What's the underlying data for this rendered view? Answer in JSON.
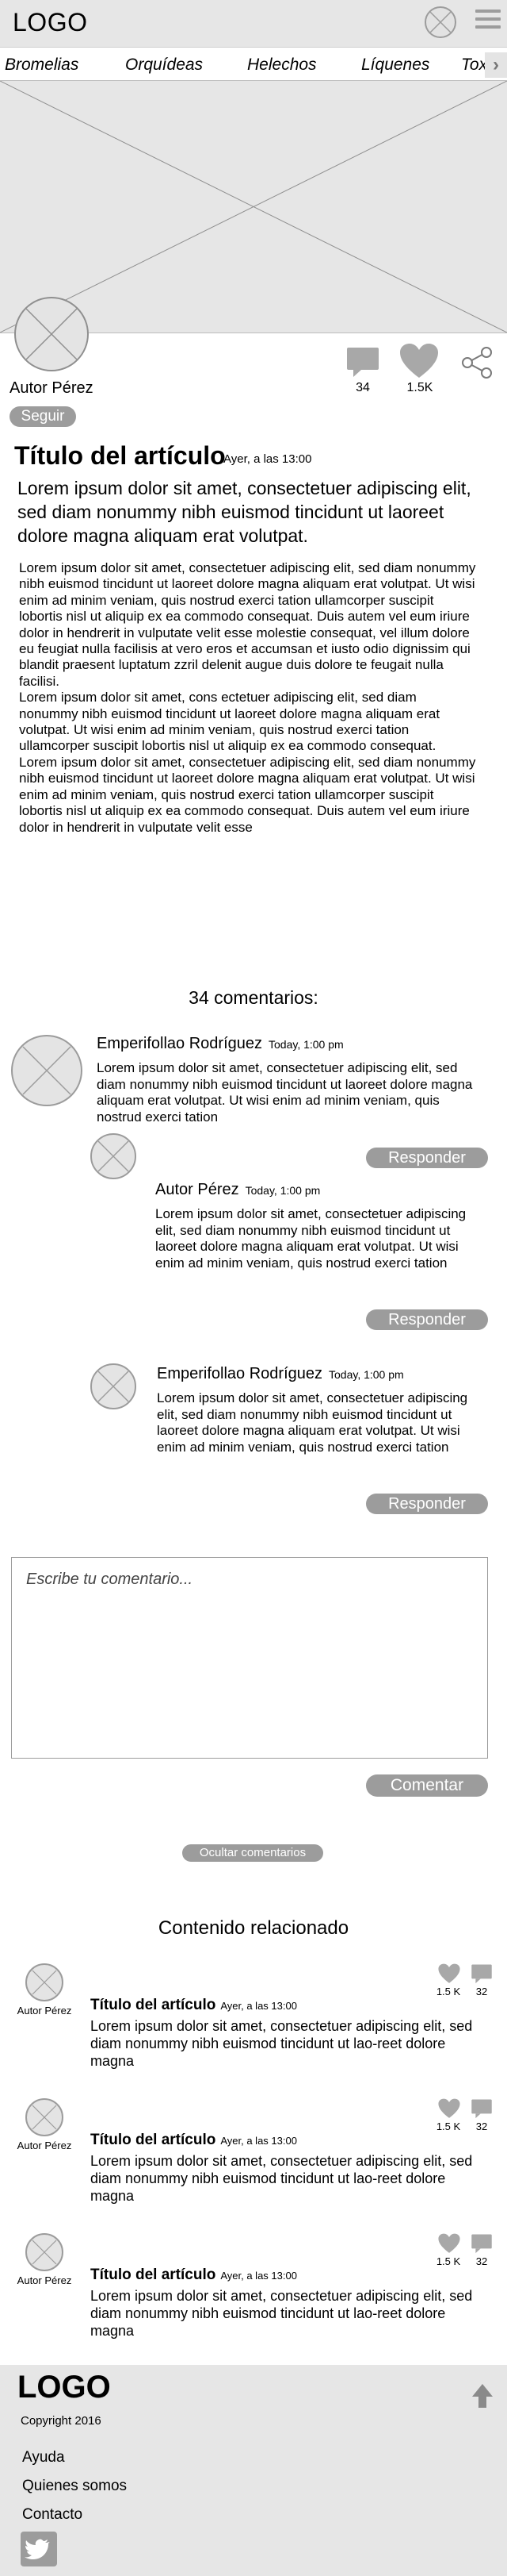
{
  "header": {
    "logo": "LOGO"
  },
  "nav": {
    "items": [
      "Bromelias",
      "Orquídeas",
      "Helechos",
      "Líquenes",
      "Tox"
    ]
  },
  "article": {
    "author": "Autor Pérez",
    "follow_label": "Seguir",
    "comment_count_label": "34",
    "likes_label": "1.5K",
    "title": "Título del artículo",
    "date": "Ayer, a las 13:00",
    "lead": "Lorem ipsum dolor sit amet, consectetuer adipiscing elit, sed diam nonummy nibh euismod tincidunt ut laoreet dolore magna aliquam erat volutpat.",
    "paragraphs": [
      "Lorem ipsum dolor sit amet, consectetuer adipiscing elit, sed diam nonummy nibh euismod tincidunt ut laoreet dolore magna aliquam erat volutpat. Ut wisi enim ad minim veniam, quis nostrud exerci tation ullamcorper suscipit lobortis nisl ut aliquip ex ea commodo consequat. Duis autem vel eum iriure dolor in hendrerit in vulputate velit esse molestie consequat, vel illum dolore eu feugiat nulla facilisis at vero eros et accumsan et iusto odio dignissim qui blandit praesent luptatum zzril delenit augue duis dolore te feugait nulla facilisi.",
      "Lorem ipsum dolor sit amet, cons ectetuer adipiscing elit, sed diam nonummy nibh euismod tincidunt ut laoreet dolore magna aliquam erat volutpat. Ut wisi enim ad minim veniam, quis nostrud exerci tation ullamcorper suscipit lobortis nisl ut aliquip ex ea commodo consequat.",
      "Lorem ipsum dolor sit amet, consectetuer adipiscing elit, sed diam nonummy nibh euismod tincidunt ut laoreet dolore magna aliquam erat volutpat. Ut wisi enim ad minim veniam, quis nostrud exerci tation ullamcorper suscipit lobortis nisl ut aliquip ex ea commodo consequat. Duis autem vel eum iriure dolor in hendrerit in vulputate velit esse"
    ]
  },
  "comments": {
    "title": "34 comentarios:",
    "reply_label": "Responder",
    "items": [
      {
        "author": "Emperifollao Rodríguez",
        "date": "Today, 1:00 pm",
        "text": "Lorem ipsum dolor sit amet, consectetuer adipiscing elit, sed diam nonummy nibh euismod tincidunt ut laoreet dolore magna aliquam erat volutpat. Ut wisi enim ad minim veniam, quis nostrud exerci tation"
      },
      {
        "author": "Autor Pérez",
        "date": "Today, 1:00 pm",
        "text": "Lorem ipsum dolor sit amet, consectetuer adipiscing elit, sed diam nonummy nibh euismod tincidunt ut laoreet dolore magna aliquam erat volutpat. Ut wisi enim ad minim veniam, quis nostrud exerci tation"
      },
      {
        "author": "Emperifollao Rodríguez",
        "date": "Today, 1:00 pm",
        "text": "Lorem ipsum dolor sit amet, consectetuer adipiscing elit, sed diam nonummy nibh euismod tincidunt ut laoreet dolore magna aliquam erat volutpat. Ut wisi enim ad minim veniam, quis nostrud exerci tation"
      }
    ],
    "input_placeholder": "Escribe tu comentario...",
    "submit_label": "Comentar",
    "hide_label": "Ocultar comentarios"
  },
  "related": {
    "title": "Contenido relacionado",
    "items": [
      {
        "author": "Autor Pérez",
        "title": "Título del artículo",
        "date": "Ayer, a las 13:00",
        "text": "Lorem ipsum dolor sit amet, consectetuer adipiscing elit, sed diam nonummy nibh euismod tincidunt ut lao-reet dolore magna",
        "likes": "1.5 K",
        "comments": "32"
      },
      {
        "author": "Autor Pérez",
        "title": "Título del artículo",
        "date": "Ayer, a las 13:00",
        "text": "Lorem ipsum dolor sit amet, consectetuer adipiscing elit, sed diam nonummy nibh euismod tincidunt ut lao-reet dolore magna",
        "likes": "1.5 K",
        "comments": "32"
      },
      {
        "author": "Autor Pérez",
        "title": "Título del artículo",
        "date": "Ayer, a las 13:00",
        "text": "Lorem ipsum dolor sit amet, consectetuer adipiscing elit, sed diam nonummy nibh euismod tincidunt ut lao-reet dolore magna",
        "likes": "1.5 K",
        "comments": "32"
      }
    ]
  },
  "footer": {
    "logo": "LOGO",
    "copyright": "Copyright 2016",
    "links": [
      "Ayuda",
      "Quienes somos",
      "Contacto"
    ]
  },
  "icons": {
    "menu": "hamburger-menu-icon",
    "user": "user-avatar-icon",
    "comment": "speech-bubble-icon",
    "like": "heart-icon",
    "share": "share-icon",
    "scroll_top": "arrow-up-icon",
    "social": "twitter-icon"
  },
  "colors": {
    "placeholder_gray": "#e6e6e6",
    "button_gray": "#9c9c9c",
    "icon_gray": "#a8a8a8"
  }
}
